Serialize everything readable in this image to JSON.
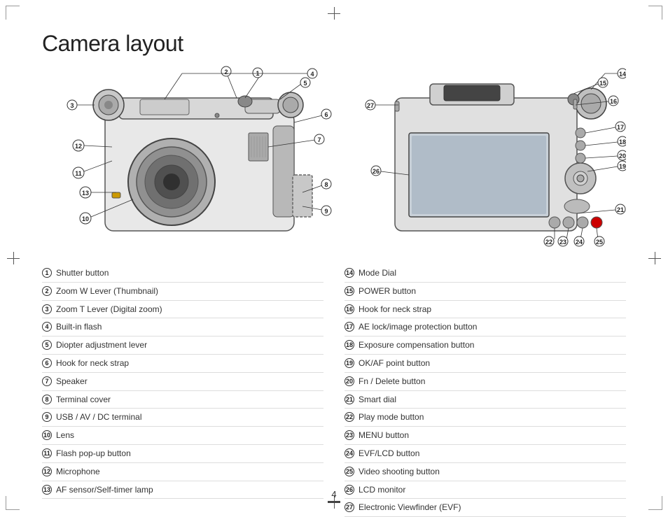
{
  "title": "Camera layout",
  "page_number": "4",
  "left_parts": [
    {
      "num": "1",
      "name": "Shutter button"
    },
    {
      "num": "2",
      "name": "Zoom W Lever (Thumbnail)"
    },
    {
      "num": "3",
      "name": "Zoom T Lever (Digital zoom)"
    },
    {
      "num": "4",
      "name": "Built-in flash"
    },
    {
      "num": "5",
      "name": "Diopter adjustment lever"
    },
    {
      "num": "6",
      "name": "Hook for neck strap"
    },
    {
      "num": "7",
      "name": "Speaker"
    },
    {
      "num": "8",
      "name": "Terminal cover"
    },
    {
      "num": "9",
      "name": "USB / AV / DC terminal"
    },
    {
      "num": "10",
      "name": "Lens"
    },
    {
      "num": "11",
      "name": "Flash pop-up button"
    },
    {
      "num": "12",
      "name": "Microphone"
    },
    {
      "num": "13",
      "name": "AF sensor/Self-timer lamp"
    }
  ],
  "right_parts": [
    {
      "num": "14",
      "name": "Mode Dial"
    },
    {
      "num": "15",
      "name": "POWER button"
    },
    {
      "num": "16",
      "name": "Hook for neck strap"
    },
    {
      "num": "17",
      "name": "AE lock/image protection button"
    },
    {
      "num": "18",
      "name": "Exposure compensation button"
    },
    {
      "num": "19",
      "name": "OK/AF point button"
    },
    {
      "num": "20",
      "name": "Fn / Delete button"
    },
    {
      "num": "21",
      "name": "Smart dial"
    },
    {
      "num": "22",
      "name": "Play mode button"
    },
    {
      "num": "23",
      "name": "MENU button"
    },
    {
      "num": "24",
      "name": "EVF/LCD button"
    },
    {
      "num": "25",
      "name": "Video shooting button"
    },
    {
      "num": "26",
      "name": "LCD monitor"
    },
    {
      "num": "27",
      "name": "Electronic Viewfinder (EVF)"
    }
  ]
}
